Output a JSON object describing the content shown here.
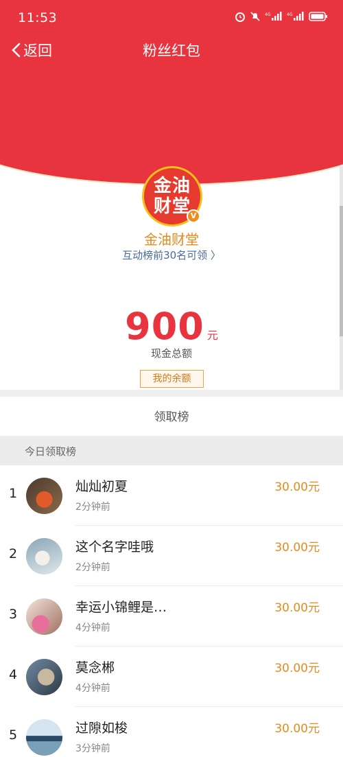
{
  "status": {
    "time": "11:53"
  },
  "nav": {
    "back_label": "返回",
    "title": "粉丝红包"
  },
  "profile": {
    "logo_line1": "金油",
    "logo_line2": "财堂",
    "verified_mark": "V",
    "name": "金油财堂",
    "subtitle": "互动榜前30名可领 〉"
  },
  "amount": {
    "value": "900",
    "unit": "元",
    "label": "现金总额"
  },
  "balance_button": "我的余额",
  "ranking": {
    "title": "领取榜",
    "today_label": "今日领取榜",
    "items": [
      {
        "rank": "1",
        "name": "灿灿初夏",
        "time": "2分钟前",
        "amount": "30.00元"
      },
      {
        "rank": "2",
        "name": "这个名字哇哦",
        "time": "2分钟前",
        "amount": "30.00元"
      },
      {
        "rank": "3",
        "name": "幸运小锦鲤是…",
        "time": "4分钟前",
        "amount": "30.00元"
      },
      {
        "rank": "4",
        "name": "莫念郴",
        "time": "4分钟前",
        "amount": "30.00元"
      },
      {
        "rank": "5",
        "name": "过隙如梭",
        "time": "3分钟前",
        "amount": "30.00元"
      }
    ]
  },
  "colors": {
    "header_red": "#e8343f",
    "accent_orange": "#e8891c",
    "link_blue": "#4a6a9a"
  },
  "icons": [
    "alarm-icon",
    "mute-icon",
    "signal-4g-icon",
    "battery-icon",
    "chevron-left-icon",
    "chevron-right-icon"
  ]
}
